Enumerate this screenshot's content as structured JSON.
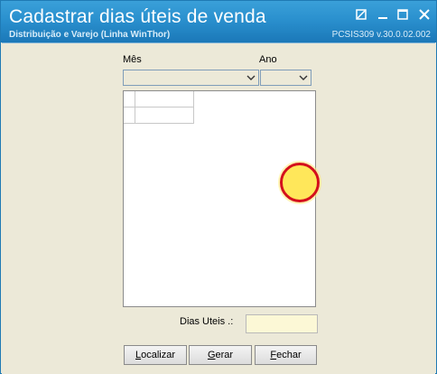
{
  "window": {
    "title": "Cadastrar dias úteis de venda",
    "subtitle": "Distribuição e Varejo (Linha WinThor)",
    "version": "PCSIS309  v.30.0.02.002",
    "controls": [
      "restore-icon",
      "minimize-icon",
      "maximize-icon",
      "close-icon"
    ]
  },
  "filters": {
    "mes_label": "Mês",
    "mes_value": "",
    "ano_label": "Ano",
    "ano_value": ""
  },
  "dias_uteis": {
    "label": "Dias Uteis   .:",
    "value": ""
  },
  "buttons": {
    "localizar_mnemonic": "L",
    "localizar_rest": "ocalizar",
    "gerar_mnemonic": "G",
    "gerar_rest": "erar",
    "fechar_mnemonic": "F",
    "fechar_rest": "echar"
  },
  "colors": {
    "titlebar": "#2a90ce",
    "client_bg": "#ece9d8",
    "input_bg": "#fcf8d6",
    "cursor_highlight": "#ffe75a",
    "cursor_ring": "#d4101c"
  }
}
